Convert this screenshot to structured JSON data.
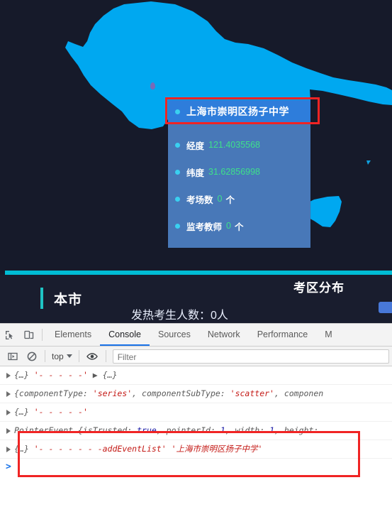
{
  "page": {
    "map": {
      "name": "choropleth-map",
      "land_color": "#00a8f0",
      "background_color": "#161a2a",
      "marker_color": "#7a6ab8"
    },
    "tooltip": {
      "title": "上海市崇明区扬子中学",
      "rows": [
        {
          "label": "经度",
          "value": "121.4035568",
          "unit": ""
        },
        {
          "label": "纬度",
          "value": "31.62856998",
          "unit": ""
        },
        {
          "label": "考场数",
          "value": "0",
          "unit": "个"
        },
        {
          "label": "监考教师",
          "value": "0",
          "unit": "个"
        }
      ],
      "bullet_color": "#3ad0f0",
      "value_color": "#3ee08a",
      "header_bg": "#2e7ddb",
      "body_bg": "#4878b8"
    },
    "panel": {
      "heading": "本市",
      "subtitle": "发热考生人数：0人",
      "right_title": "考区分布",
      "accent_color": "#1fc4c4",
      "divider_color": "#00bcd4"
    }
  },
  "devtools": {
    "tabs": [
      {
        "label": "Elements",
        "active": false
      },
      {
        "label": "Console",
        "active": true
      },
      {
        "label": "Sources",
        "active": false
      },
      {
        "label": "Network",
        "active": false
      },
      {
        "label": "Performance",
        "active": false
      },
      {
        "label": "M",
        "active": false
      }
    ],
    "toolbar": {
      "inspect_icon": "inspect-element-icon",
      "device_icon": "device-toolbar-icon",
      "sidebar_icon": "console-sidebar-icon",
      "clear_icon": "clear-console-icon",
      "eye_icon": "live-expression-icon",
      "context": "top",
      "filter_placeholder": "Filter"
    },
    "console_rows": [
      {
        "tokens": [
          {
            "t": "{…} ",
            "c": "tok-obj"
          },
          {
            "t": "'- - - - -'",
            "c": "tok-str"
          },
          {
            "t": "  ▶ {…}",
            "c": "tok-obj"
          }
        ]
      },
      {
        "tokens": [
          {
            "t": "{componentType: ",
            "c": "tok-obj"
          },
          {
            "t": "'series'",
            "c": "tok-str"
          },
          {
            "t": ", componentSubType: ",
            "c": "tok-obj"
          },
          {
            "t": "'scatter'",
            "c": "tok-str"
          },
          {
            "t": ", componen",
            "c": "tok-obj"
          }
        ]
      },
      {
        "tokens": [
          {
            "t": "{…} ",
            "c": "tok-obj"
          },
          {
            "t": "'- - - - -'",
            "c": "tok-str"
          }
        ]
      },
      {
        "tokens": [
          {
            "t": "PointerEvent {isTrusted: ",
            "c": "tok-obj"
          },
          {
            "t": "true",
            "c": "tok-kw"
          },
          {
            "t": ", pointerId: ",
            "c": "tok-obj"
          },
          {
            "t": "1",
            "c": "tok-num"
          },
          {
            "t": ", width: ",
            "c": "tok-obj"
          },
          {
            "t": "1",
            "c": "tok-num"
          },
          {
            "t": ", height:",
            "c": "tok-obj"
          }
        ]
      },
      {
        "tokens": [
          {
            "t": "{…} ",
            "c": "tok-obj"
          },
          {
            "t": "'- - - - - - -addEventList'",
            "c": "tok-str"
          },
          {
            "t": " ",
            "c": "tok-obj"
          },
          {
            "t": "'上海市崇明区扬子中学'",
            "c": "tok-str"
          }
        ]
      }
    ],
    "prompt_symbol": ">"
  },
  "highlights": {
    "tooltip_title_box_color": "#f02424",
    "console_box_color": "#f02424"
  }
}
